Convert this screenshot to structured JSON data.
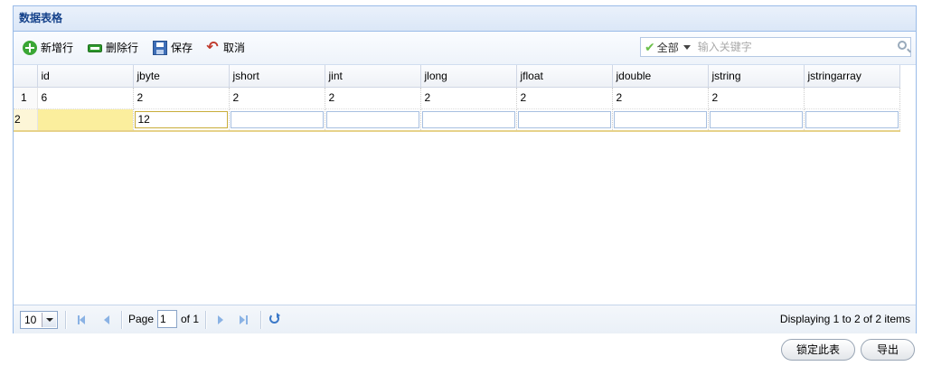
{
  "panel": {
    "title": "数据表格"
  },
  "toolbar": {
    "add_label": "新增行",
    "delete_label": "删除行",
    "save_label": "保存",
    "cancel_label": "取消",
    "search_scope": "全部",
    "search_placeholder": "输入关键字"
  },
  "grid": {
    "columns": [
      "id",
      "jbyte",
      "jshort",
      "jint",
      "jlong",
      "jfloat",
      "jdouble",
      "jstring",
      "jstringarray"
    ],
    "rows": [
      {
        "num": "1",
        "cells": [
          "6",
          "2",
          "2",
          "2",
          "2",
          "2",
          "2",
          "2",
          ""
        ]
      },
      {
        "num": "2",
        "cells": [
          "",
          "12",
          "",
          "",
          "",
          "",
          "",
          "",
          ""
        ]
      }
    ]
  },
  "pager": {
    "page_size": "10",
    "page_label": "Page",
    "page_value": "1",
    "of_label": "of 1",
    "info": "Displaying 1 to 2 of 2 items"
  },
  "actions": {
    "lock_label": "锁定此表",
    "export_label": "导出"
  },
  "colors": {
    "header_text": "#15428b",
    "border": "#99bbe8",
    "edit_highlight": "#fbee9d"
  }
}
